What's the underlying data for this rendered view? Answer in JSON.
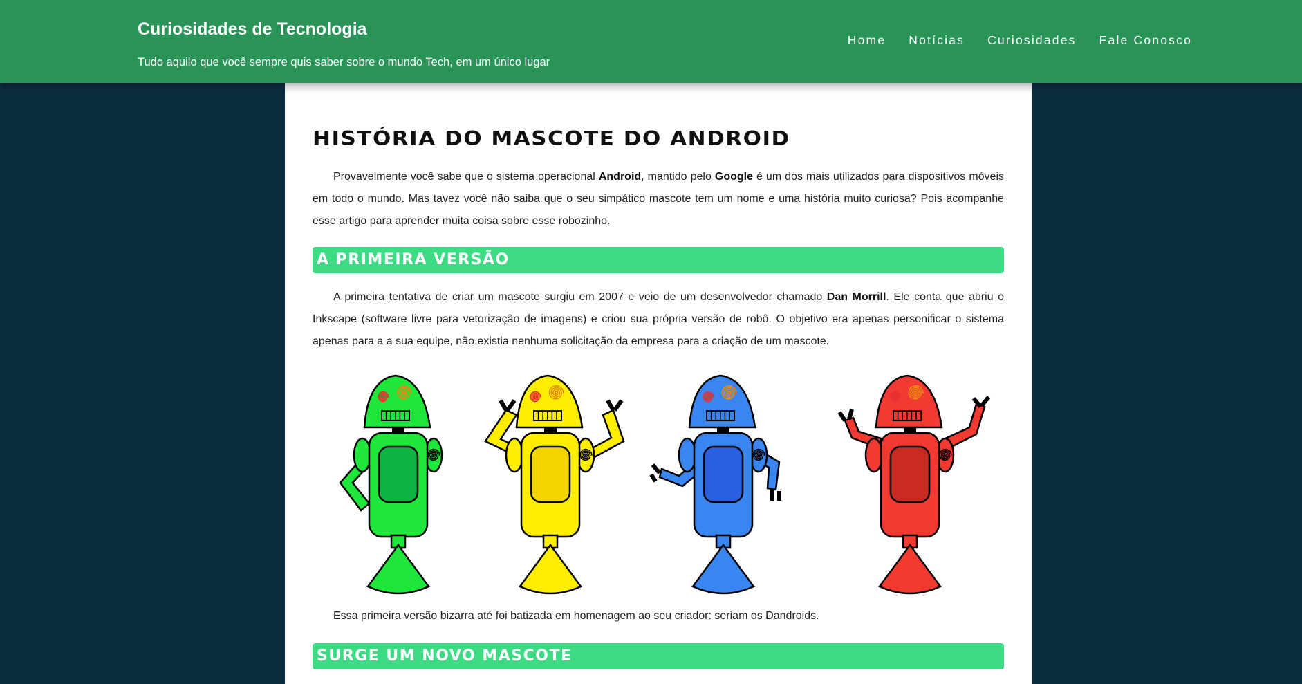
{
  "header": {
    "site_title": "Curiosidades de Tecnologia",
    "tagline": "Tudo aquilo que você sempre quis saber sobre o mundo Tech, em um único lugar",
    "nav": [
      {
        "label": "Home"
      },
      {
        "label": "Notícias"
      },
      {
        "label": "Curiosidades"
      },
      {
        "label": "Fale Conosco"
      }
    ]
  },
  "article": {
    "title": "HISTÓRIA DO MASCOTE DO ANDROID",
    "intro": {
      "t1": "Provavelmente você sabe que o sistema operacional ",
      "b1": "Android",
      "t2": ", mantido pelo ",
      "b2": "Google",
      "t3": " é um dos mais utilizados para dispositivos móveis em todo o mundo. Mas tavez você não saiba que o seu simpático mascote tem um nome e uma história muito curiosa? Pois acompanhe esse artigo para aprender muita coisa sobre esse robozinho."
    },
    "section1_title": "A PRIMEIRA VERSÃO",
    "section1_p": {
      "t1": "A primeira tentativa de criar um mascote surgiu em 2007 e veio de um desenvolvedor chamado ",
      "b1": "Dan Morrill",
      "t2": ". Ele conta que abriu o Inkscape (software livre para vetorização de imagens) e criou sua própria versão de robô. O objetivo era apenas personificar o sistema apenas para a a sua equipe, não existia nenhuma solicitação da empresa para a criação de um mascote."
    },
    "caption_p": "Essa primeira versão bizarra até foi batizada em homenagem ao seu criador: seriam os Dandroids.",
    "section2_title": "SURGE UM NOVO MASCOTE"
  },
  "robots": [
    {
      "name": "green-dandroid",
      "color": "#1ee63a",
      "dark": "#0fb343"
    },
    {
      "name": "yellow-dandroid",
      "color": "#ffee00",
      "dark": "#f2d500"
    },
    {
      "name": "blue-dandroid",
      "color": "#3a86f0",
      "dark": "#2a5fe0"
    },
    {
      "name": "red-dandroid",
      "color": "#f03a32",
      "dark": "#c92a22"
    }
  ],
  "colors": {
    "header_bg": "#2a9458",
    "page_bg": "#0c2d40",
    "section_bar": "#3ddc84"
  }
}
